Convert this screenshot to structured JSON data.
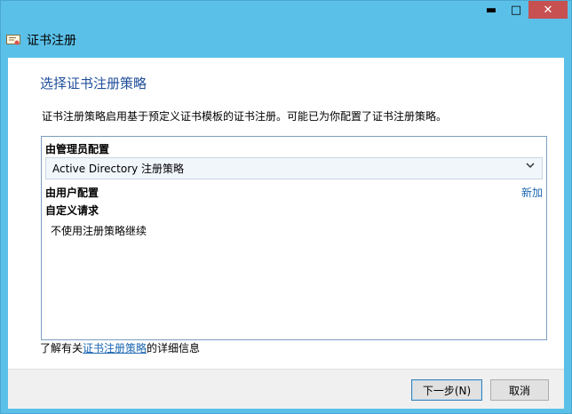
{
  "window": {
    "title": "证书注册",
    "controls": {
      "minimize": "▬",
      "maximize": "□",
      "close": "✕"
    }
  },
  "page": {
    "heading": "选择证书注册策略",
    "description": "证书注册策略启用基于预定义证书模板的证书注册。可能已为你配置了证书注册策略。"
  },
  "policies": {
    "admin_section": "由管理员配置",
    "admin_selected": "Active Directory 注册策略",
    "user_section": "由用户配置",
    "add_link": "新加",
    "custom_section": "自定义请求",
    "inherit_option": "不使用注册策略继续"
  },
  "footer": {
    "learn_prefix": "了解有关",
    "learn_link": "证书注册策略",
    "learn_suffix": "的详细信息"
  },
  "buttons": {
    "next": "下一步(N)",
    "cancel": "取消"
  }
}
